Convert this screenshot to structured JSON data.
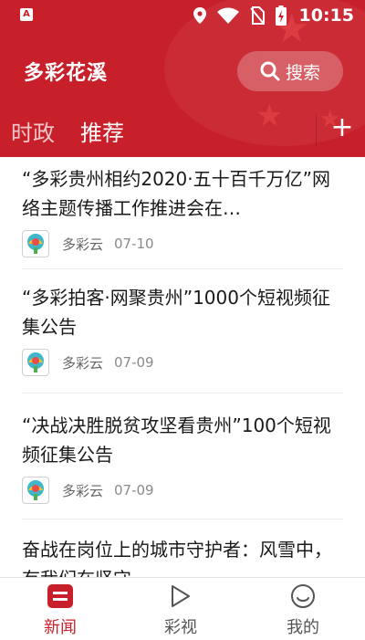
{
  "status_bar": {
    "time": "10:15",
    "carrier_badge": "A"
  },
  "header": {
    "app_title": "多彩花溪",
    "search_label": "搜索"
  },
  "tabs": [
    {
      "label": "时政",
      "active": false
    },
    {
      "label": "推荐",
      "active": true
    }
  ],
  "tab_add_label": "+",
  "articles": [
    {
      "title": "“多彩贵州相约2020·五十百千万亿”网络主题传播工作推进会在…",
      "source": "多彩云",
      "date": "07-10"
    },
    {
      "title": "“多彩拍客·网聚贵州”1000个短视频征集公告",
      "source": "多彩云",
      "date": "07-09"
    },
    {
      "title": "“决战决胜脱贫攻坚看贵州”100个短视频征集公告",
      "source": "多彩云",
      "date": "07-09"
    },
    {
      "title": "奋战在岗位上的城市守护者：风雪中，有我们在坚守",
      "source": "",
      "date": ""
    }
  ],
  "bottom_nav": [
    {
      "label": "新闻",
      "icon": "news-icon",
      "active": true
    },
    {
      "label": "彩视",
      "icon": "play-icon",
      "active": false
    },
    {
      "label": "我的",
      "icon": "smile-icon",
      "active": false
    }
  ],
  "colors": {
    "brand_red": "#c8202b",
    "text": "#1a1a1a",
    "meta": "#8a8a8a"
  }
}
